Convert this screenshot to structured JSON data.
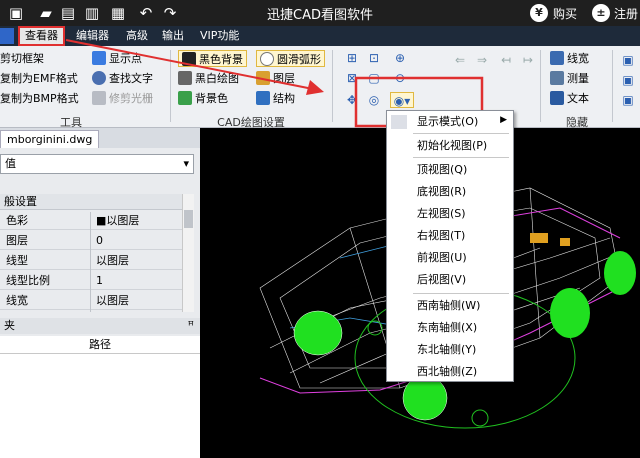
{
  "app": {
    "title": "迅捷CAD看图软件",
    "buy_label": "购买",
    "register_label": "注册"
  },
  "menu": {
    "items": [
      "查看器",
      "编辑器",
      "高级",
      "输出",
      "VIP功能"
    ]
  },
  "ribbon": {
    "tools_group": {
      "label": "工具",
      "items": [
        "剪切框架",
        "复制为EMF格式",
        "复制为BMP格式",
        "显示点",
        "查找文字",
        "修剪光栅"
      ]
    },
    "cad_group": {
      "label": "CAD绘图设置",
      "items": [
        "黑色背景",
        "黑白绘图",
        "背景色",
        "圆滑弧形",
        "图层",
        "结构"
      ]
    },
    "hide_group": {
      "label": "隐藏",
      "items": [
        "线宽",
        "测量",
        "文本"
      ]
    }
  },
  "left_panel": {
    "tab": "mborginini.dwg",
    "dropdown_value": "值",
    "section": "般设置",
    "properties": [
      {
        "key": "色彩",
        "value": "■以图层"
      },
      {
        "key": "图层",
        "value": "0"
      },
      {
        "key": "线型",
        "value": "以图层"
      },
      {
        "key": "线型比例",
        "value": "1"
      },
      {
        "key": "线宽",
        "value": "以图层"
      }
    ],
    "lower_title": "夹",
    "lower_column": "路径"
  },
  "dropdown_menu": {
    "items": [
      "显示模式(O)",
      "初始化视图(P)",
      "顶视图(Q)",
      "底视图(R)",
      "左视图(S)",
      "右视图(T)",
      "前视图(U)",
      "后视图(V)",
      "西南轴侧(W)",
      "东南轴侧(X)",
      "东北轴侧(Y)",
      "西北轴侧(Z)"
    ]
  },
  "colors": {
    "title_bg": "#1f1f1f",
    "highlight_red": "#e03030",
    "cad_green": "#20e020",
    "cad_magenta": "#e040e0"
  }
}
